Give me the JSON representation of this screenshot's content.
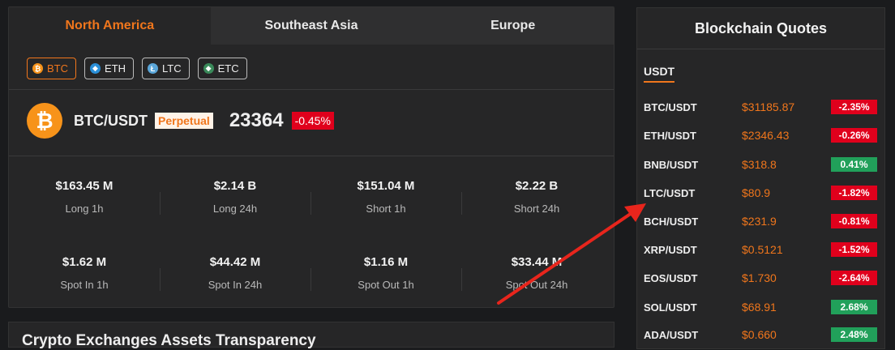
{
  "tabs": [
    {
      "label": "North America",
      "active": true
    },
    {
      "label": "Southeast Asia",
      "active": false
    },
    {
      "label": "Europe",
      "active": false
    }
  ],
  "coins": [
    {
      "label": "BTC",
      "icon": "btc-icon",
      "color": "#f7931a",
      "glyph": "₿",
      "active": true
    },
    {
      "label": "ETH",
      "icon": "eth-icon",
      "color": "#2a8fd8",
      "glyph": "◆",
      "active": false
    },
    {
      "label": "LTC",
      "icon": "ltc-icon",
      "color": "#5aa6d9",
      "glyph": "Ł",
      "active": false
    },
    {
      "label": "ETC",
      "icon": "etc-icon",
      "color": "#3a8a5a",
      "glyph": "◆",
      "active": false
    }
  ],
  "ticker": {
    "pair": "BTC/USDT",
    "tag": "Perpetual",
    "price": "23364",
    "change": "-0.45%",
    "icon_glyph": "₿"
  },
  "stats": [
    {
      "value": "$163.45 M",
      "label": "Long 1h"
    },
    {
      "value": "$2.14 B",
      "label": "Long 24h"
    },
    {
      "value": "$151.04 M",
      "label": "Short 1h"
    },
    {
      "value": "$2.22 B",
      "label": "Short 24h"
    },
    {
      "value": "$1.62 M",
      "label": "Spot In 1h"
    },
    {
      "value": "$44.42 M",
      "label": "Spot In 24h"
    },
    {
      "value": "$1.16 M",
      "label": "Spot Out 1h"
    },
    {
      "value": "$33.44 M",
      "label": "Spot Out 24h"
    }
  ],
  "next_section_title": "Crypto Exchanges Assets Transparency",
  "quotes": {
    "title": "Blockchain Quotes",
    "tab": "USDT",
    "rows": [
      {
        "pair": "BTC/USDT",
        "price": "$31185.87",
        "change": "-2.35%",
        "dir": "neg"
      },
      {
        "pair": "ETH/USDT",
        "price": "$2346.43",
        "change": "-0.26%",
        "dir": "neg"
      },
      {
        "pair": "BNB/USDT",
        "price": "$318.8",
        "change": "0.41%",
        "dir": "pos"
      },
      {
        "pair": "LTC/USDT",
        "price": "$80.9",
        "change": "-1.82%",
        "dir": "neg"
      },
      {
        "pair": "BCH/USDT",
        "price": "$231.9",
        "change": "-0.81%",
        "dir": "neg"
      },
      {
        "pair": "XRP/USDT",
        "price": "$0.5121",
        "change": "-1.52%",
        "dir": "neg"
      },
      {
        "pair": "EOS/USDT",
        "price": "$1.730",
        "change": "-2.64%",
        "dir": "neg"
      },
      {
        "pair": "SOL/USDT",
        "price": "$68.91",
        "change": "2.68%",
        "dir": "pos"
      },
      {
        "pair": "ADA/USDT",
        "price": "$0.660",
        "change": "2.48%",
        "dir": "pos"
      }
    ]
  },
  "colors": {
    "accent": "#f0761c",
    "negative": "#e0001c",
    "positive": "#21a05a",
    "annotation_arrow": "#e8251c"
  }
}
